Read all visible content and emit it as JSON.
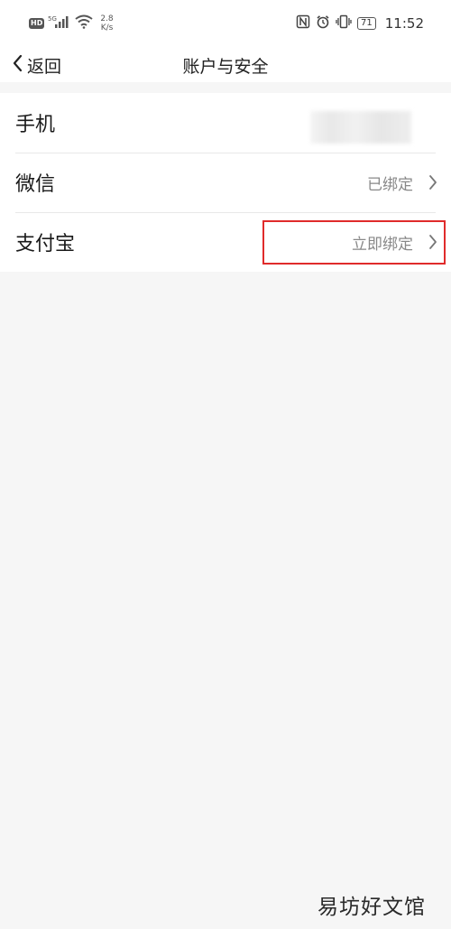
{
  "status_bar": {
    "hd": "HD",
    "signal": "5G",
    "net_speed_value": "2.8",
    "net_speed_unit": "K/s",
    "battery": "71",
    "time": "11:52",
    "icons": [
      "nfc-icon",
      "alarm-icon",
      "vibrate-icon",
      "battery-icon"
    ]
  },
  "nav": {
    "back_label": "返回",
    "title": "账户与安全"
  },
  "rows": [
    {
      "label": "手机",
      "value": ""
    },
    {
      "label": "微信",
      "value": "已绑定"
    },
    {
      "label": "支付宝",
      "value": "立即绑定"
    }
  ],
  "annotation_color": "#e02b2b",
  "watermark": "易坊好文馆"
}
